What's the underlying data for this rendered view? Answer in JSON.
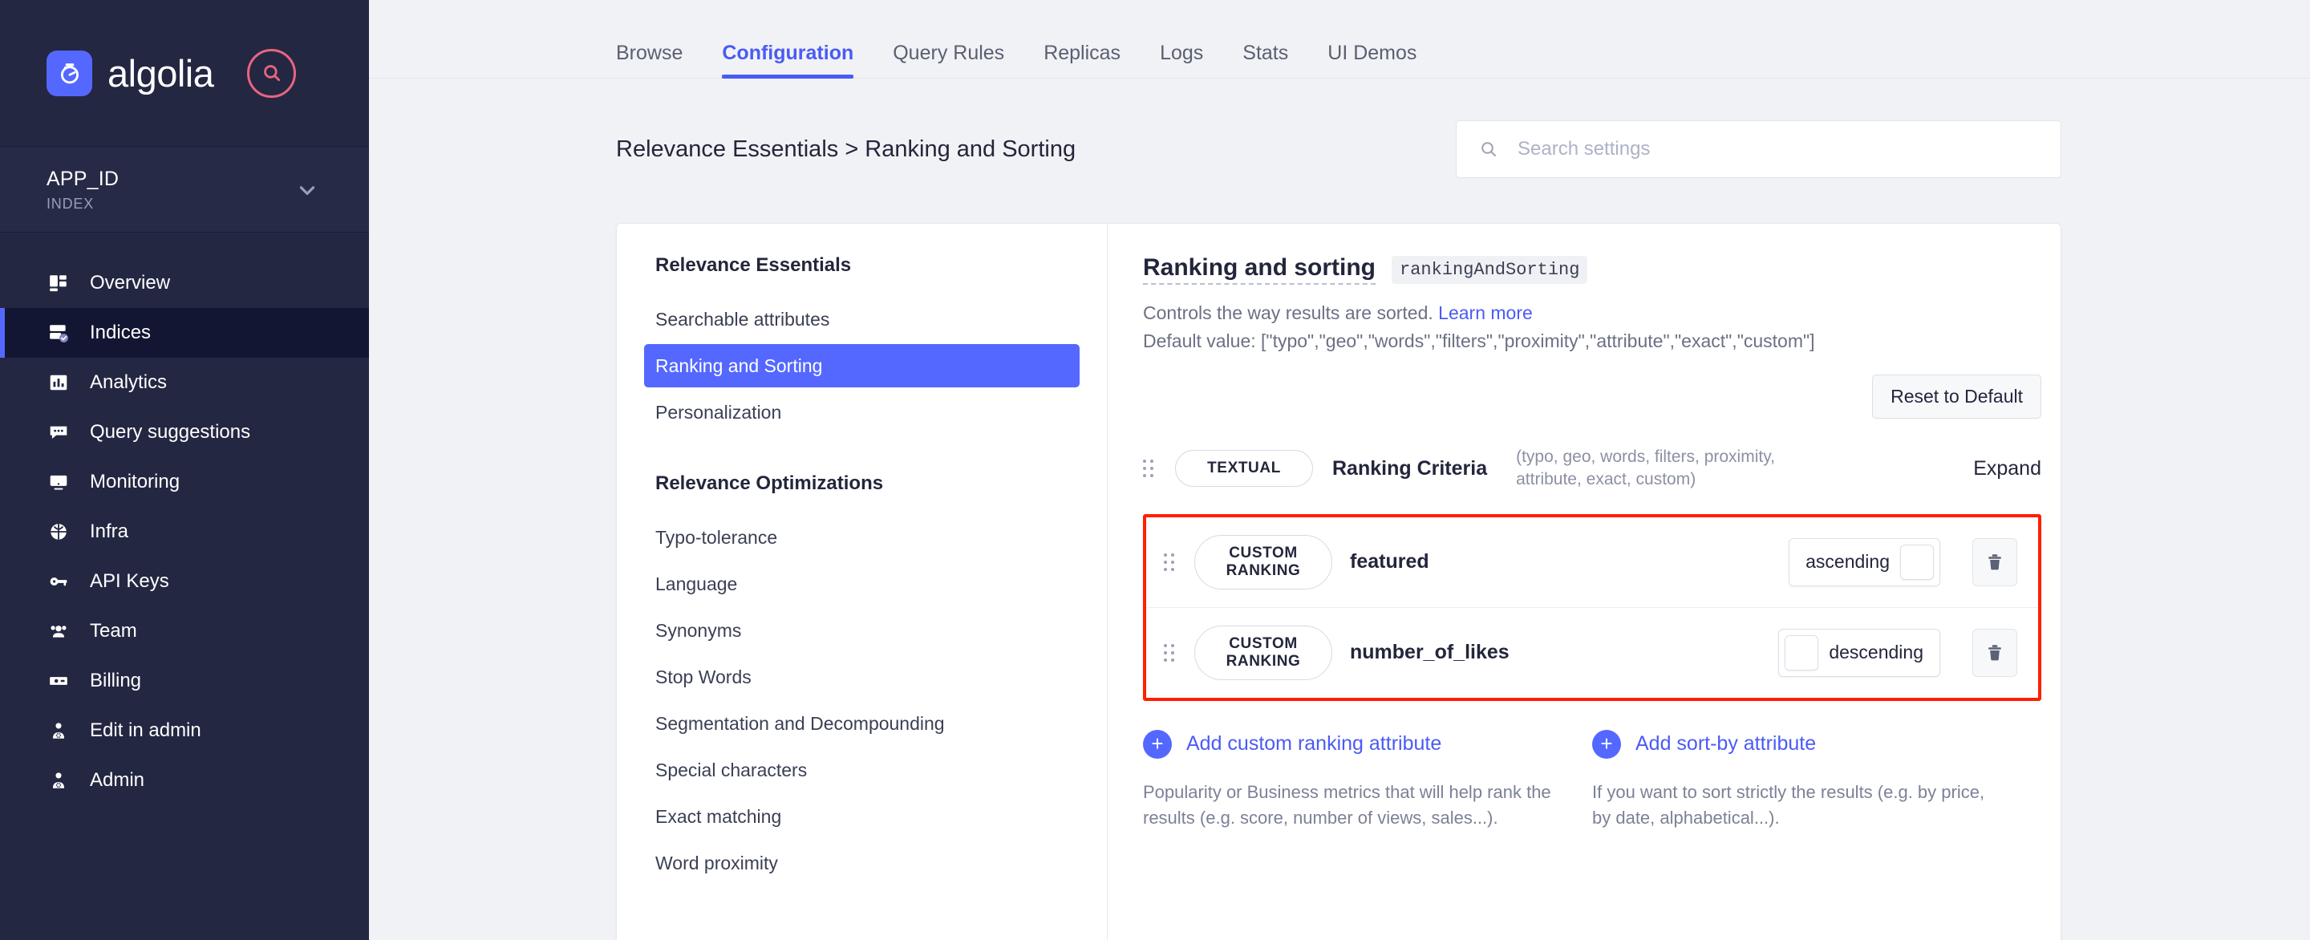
{
  "sidebar": {
    "brand": "algolia",
    "search_icon": "search-icon",
    "app_id": "APP_ID",
    "index": "INDEX",
    "chevron": "chevron-down-icon",
    "nav": [
      {
        "label": "Overview",
        "icon": "dashboard-icon",
        "active": false
      },
      {
        "label": "Indices",
        "icon": "database-check-icon",
        "active": true
      },
      {
        "label": "Analytics",
        "icon": "bar-chart-icon",
        "active": false
      },
      {
        "label": "Query suggestions",
        "icon": "chat-icon",
        "active": false
      },
      {
        "label": "Monitoring",
        "icon": "monitor-icon",
        "active": false
      },
      {
        "label": "Infra",
        "icon": "globe-icon",
        "active": false
      },
      {
        "label": "API Keys",
        "icon": "key-icon",
        "active": false
      },
      {
        "label": "Team",
        "icon": "users-icon",
        "active": false
      },
      {
        "label": "Billing",
        "icon": "money-icon",
        "active": false
      },
      {
        "label": "Edit in admin",
        "icon": "user-gear-icon",
        "active": false
      },
      {
        "label": "Admin",
        "icon": "user-gear-icon",
        "active": false
      }
    ]
  },
  "tabs": [
    {
      "label": "Browse",
      "active": false
    },
    {
      "label": "Configuration",
      "active": true
    },
    {
      "label": "Query Rules",
      "active": false
    },
    {
      "label": "Replicas",
      "active": false
    },
    {
      "label": "Logs",
      "active": false
    },
    {
      "label": "Stats",
      "active": false
    },
    {
      "label": "UI Demos",
      "active": false
    }
  ],
  "page": {
    "title": "Relevance Essentials > Ranking and Sorting",
    "search_placeholder": "Search settings",
    "search_value": "",
    "search_icon": "search-icon"
  },
  "settings_menu": {
    "group1_title": "Relevance Essentials",
    "group1_items": [
      {
        "label": "Searchable attributes",
        "selected": false
      },
      {
        "label": "Ranking and Sorting",
        "selected": true
      },
      {
        "label": "Personalization",
        "selected": false
      }
    ],
    "group2_title": "Relevance Optimizations",
    "group2_items": [
      {
        "label": "Typo-tolerance",
        "selected": false
      },
      {
        "label": "Language",
        "selected": false
      },
      {
        "label": "Synonyms",
        "selected": false
      },
      {
        "label": "Stop Words",
        "selected": false
      },
      {
        "label": "Segmentation and Decompounding",
        "selected": false
      },
      {
        "label": "Special characters",
        "selected": false
      },
      {
        "label": "Exact matching",
        "selected": false
      },
      {
        "label": "Word proximity",
        "selected": false
      }
    ]
  },
  "panel": {
    "title": "Ranking and sorting",
    "code_chip": "rankingAndSorting",
    "description": "Controls the way results are sorted.",
    "learn_more": "Learn more",
    "default_value": "Default value: [\"typo\",\"geo\",\"words\",\"filters\",\"proximity\",\"attribute\",\"exact\",\"custom\"]",
    "reset_button": "Reset to Default",
    "ranking_criteria": {
      "badge": "TEXTUAL",
      "name": "Ranking Criteria",
      "hint": "(typo, geo, words, filters, proximity, attribute, exact, custom)",
      "expand": "Expand",
      "drag_handle": "drag-handle-icon"
    },
    "custom_ranking_rows": [
      {
        "badge": "CUSTOM RANKING",
        "attribute": "featured",
        "direction": "ascending",
        "knob_side": "right",
        "delete_icon": "trash-icon",
        "drag_handle": "drag-handle-icon"
      },
      {
        "badge": "CUSTOM RANKING",
        "attribute": "number_of_likes",
        "direction": "descending",
        "knob_side": "left",
        "delete_icon": "trash-icon",
        "drag_handle": "drag-handle-icon"
      }
    ],
    "add_actions": [
      {
        "label": "Add custom ranking attribute",
        "description": "Popularity or Business metrics that will help rank the results (e.g. score, number of views, sales...)."
      },
      {
        "label": "Add sort-by attribute",
        "description": "If you want to sort strictly the results (e.g. by price, by date, alphabetical...)."
      }
    ]
  },
  "colors": {
    "sidebar_bg": "#242742",
    "sidebar_active": "#131633",
    "accent_blue": "#5468ff",
    "link_blue": "#4a5bf5",
    "highlight_red": "#ff1f00",
    "page_bg": "#f1f2f5",
    "logo_pink": "#e8657f"
  }
}
